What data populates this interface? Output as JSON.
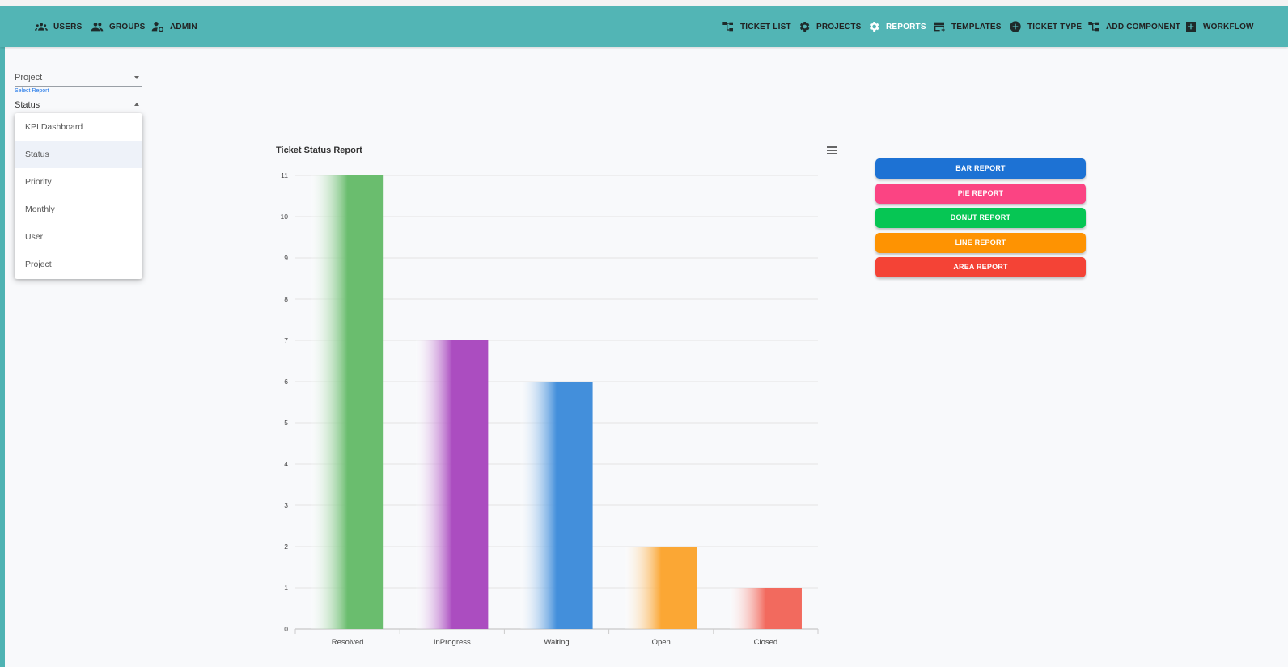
{
  "nav": {
    "left": [
      {
        "label": "USERS",
        "icon": "users-group-icon"
      },
      {
        "label": "GROUPS",
        "icon": "groups-icon"
      },
      {
        "label": "ADMIN",
        "icon": "admin-gear-user-icon"
      }
    ],
    "right": [
      {
        "label": "TICKET LIST",
        "icon": "hierarchy-icon"
      },
      {
        "label": "PROJECTS",
        "icon": "gear-icon"
      },
      {
        "label": "REPORTS",
        "icon": "gear-icon",
        "active": true
      },
      {
        "label": "TEMPLATES",
        "icon": "card-plus-icon"
      },
      {
        "label": "TICKET TYPE",
        "icon": "add-circle-icon"
      },
      {
        "label": "ADD COMPONENT",
        "icon": "hierarchy-icon"
      },
      {
        "label": "WORKFLOW",
        "icon": "add-box-icon"
      }
    ]
  },
  "filters": {
    "project": {
      "value": "Project"
    },
    "report": {
      "label": "Select Report",
      "value": "Status"
    }
  },
  "dropdown": {
    "options": [
      "KPI Dashboard",
      "Status",
      "Priority",
      "Monthly",
      "User",
      "Project"
    ],
    "selected": "Status"
  },
  "chart_title": "Ticket Status Report",
  "chart_data": {
    "type": "bar",
    "title": "Ticket Status Report",
    "categories": [
      "Resolved",
      "InProgress",
      "Waiting",
      "Open",
      "Closed"
    ],
    "values": [
      11,
      7,
      6,
      2,
      1
    ],
    "colors": [
      "#6abd6e",
      "#ab4dc0",
      "#438fdb",
      "#fba734",
      "#f26a5e"
    ],
    "ylim": [
      0,
      11
    ],
    "yticks": [
      0,
      1,
      2,
      3,
      4,
      5,
      6,
      7,
      8,
      9,
      10,
      11
    ],
    "grid": true,
    "xlabel": "",
    "ylabel": ""
  },
  "report_buttons": [
    {
      "label": "BAR REPORT",
      "color": "#1d72d4"
    },
    {
      "label": "PIE REPORT",
      "color": "#fb4483"
    },
    {
      "label": "DONUT REPORT",
      "color": "#06c654"
    },
    {
      "label": "LINE REPORT",
      "color": "#fe9302"
    },
    {
      "label": "AREA REPORT",
      "color": "#f44336"
    }
  ]
}
